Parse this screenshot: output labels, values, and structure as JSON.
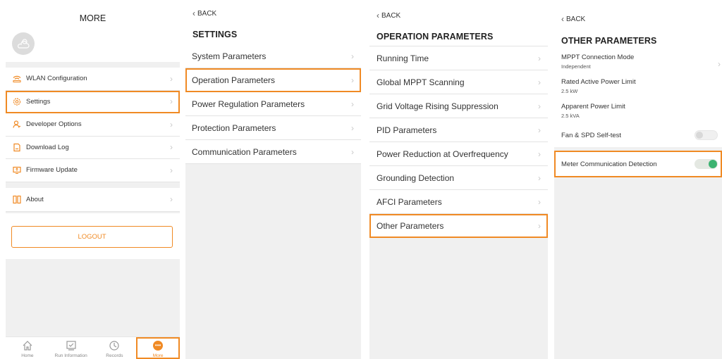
{
  "more": {
    "title": "MORE",
    "menu": [
      {
        "label": "WLAN Configuration",
        "icon": "wifi-icon"
      },
      {
        "label": "Settings",
        "icon": "gear-icon"
      },
      {
        "label": "Developer Options",
        "icon": "user-icon"
      },
      {
        "label": "Download Log",
        "icon": "document-icon"
      },
      {
        "label": "Firmware Update",
        "icon": "update-icon"
      },
      {
        "label": "About",
        "icon": "info-icon"
      }
    ],
    "logout": "LOGOUT",
    "tabs": [
      {
        "label": "Home",
        "icon": "home-icon"
      },
      {
        "label": "Run Information",
        "icon": "checklist-icon"
      },
      {
        "label": "Records",
        "icon": "clock-icon"
      },
      {
        "label": "More",
        "icon": "more-icon"
      }
    ]
  },
  "settings": {
    "back": "BACK",
    "title": "SETTINGS",
    "items": [
      "System Parameters",
      "Operation Parameters",
      "Power Regulation Parameters",
      "Protection Parameters",
      "Communication Parameters"
    ]
  },
  "operation": {
    "back": "BACK",
    "title": "OPERATION PARAMETERS",
    "items": [
      "Running Time",
      "Global MPPT Scanning",
      "Grid Voltage Rising Suppression",
      "PID Parameters",
      "Power Reduction at Overfrequency",
      "Grounding Detection",
      "AFCI Parameters",
      "Other Parameters"
    ]
  },
  "other": {
    "back": "BACK",
    "title": "OTHER PARAMETERS",
    "params": [
      {
        "label": "MPPT Connection Mode",
        "value": "Independent"
      },
      {
        "label": "Rated Active Power Limit",
        "value": "2.5 kW"
      },
      {
        "label": "Apparent Power Limit",
        "value": "2.5 kVA"
      }
    ],
    "toggles": [
      {
        "label": "Fan & SPD Self-test",
        "state": "off"
      },
      {
        "label": "Meter Communication Detection",
        "state": "on"
      }
    ]
  },
  "colors": {
    "accent": "#f08a24",
    "toggle_on": "#3cb371"
  }
}
